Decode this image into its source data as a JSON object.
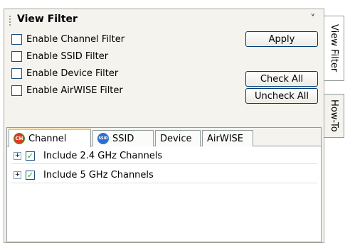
{
  "panel": {
    "title": "View Filter",
    "pin_glyph": "⍠",
    "filters": [
      {
        "label": "Enable Channel Filter",
        "checked": false
      },
      {
        "label": "Enable SSID Filter",
        "checked": false
      },
      {
        "label": "Enable Device Filter",
        "checked": false
      },
      {
        "label": "Enable AirWISE Filter",
        "checked": false
      }
    ],
    "buttons": {
      "apply": "Apply",
      "check_all": "Check All",
      "uncheck_all": "Uncheck All"
    },
    "tabs": [
      {
        "label": "Channel",
        "icon": "channel-icon",
        "icon_text": "CH",
        "active": true
      },
      {
        "label": "SSID",
        "icon": "ssid-icon",
        "icon_text": "SSID",
        "active": false
      },
      {
        "label": "Device",
        "active": false
      },
      {
        "label": "AirWISE",
        "active": false
      }
    ],
    "tree": [
      {
        "label": "Include 2.4 GHz Channels",
        "checked": true,
        "expand": "+"
      },
      {
        "label": "Include 5 GHz Channels",
        "checked": true,
        "expand": "+"
      }
    ]
  },
  "side_tabs": [
    {
      "label": "View Filter",
      "active": true
    },
    {
      "label": "How-To",
      "active": false
    }
  ],
  "colors": {
    "accent_tab": "#ffc83c",
    "check_mark": "#21a121"
  }
}
